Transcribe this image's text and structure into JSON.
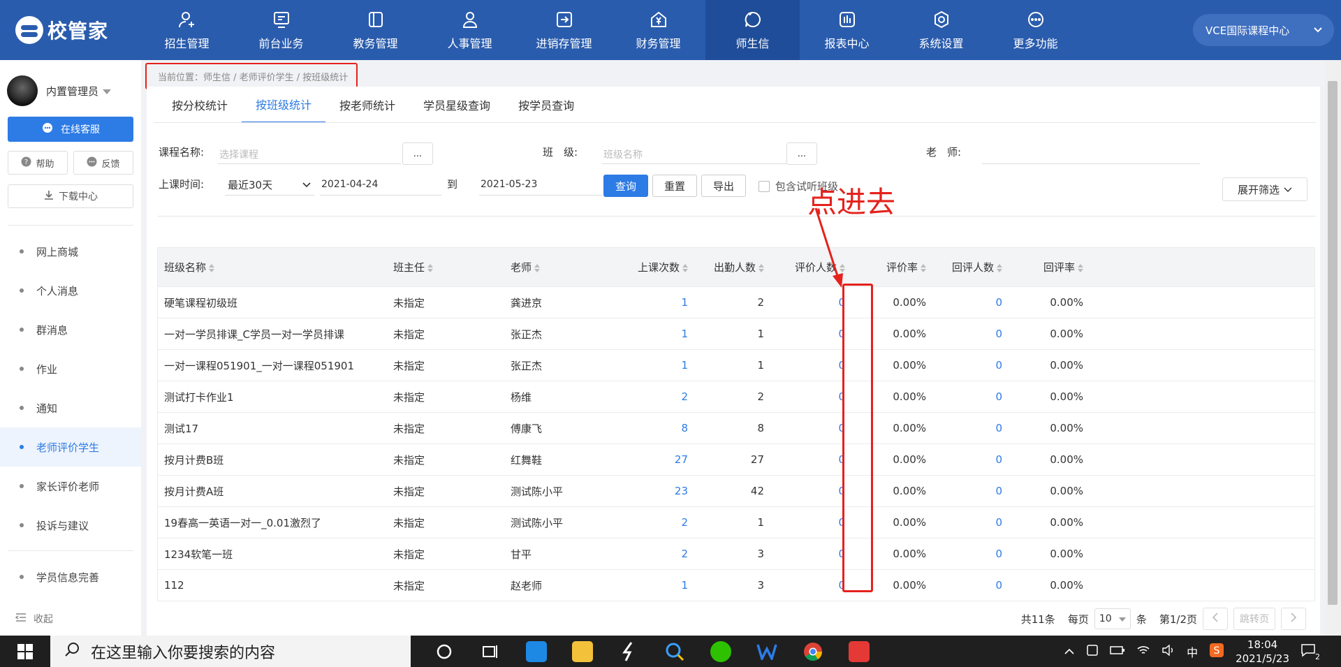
{
  "app": {
    "logo_text": "校管家",
    "campus": "VCE国际课程中心"
  },
  "nav": [
    {
      "label": "招生管理",
      "icon": "user-add-icon"
    },
    {
      "label": "前台业务",
      "icon": "monitor-icon"
    },
    {
      "label": "教务管理",
      "icon": "book-icon"
    },
    {
      "label": "人事管理",
      "icon": "person-icon"
    },
    {
      "label": "进销存管理",
      "icon": "export-icon"
    },
    {
      "label": "财务管理",
      "icon": "yen-icon"
    },
    {
      "label": "师生信",
      "icon": "message-icon",
      "active": true
    },
    {
      "label": "报表中心",
      "icon": "report-icon"
    },
    {
      "label": "系统设置",
      "icon": "settings-icon"
    },
    {
      "label": "更多功能",
      "icon": "more-icon"
    }
  ],
  "sidebar": {
    "user_name": "内置管理员",
    "service_label": "在线客服",
    "help_label": "帮助",
    "feedback_label": "反馈",
    "download_label": "下载中心",
    "items": [
      {
        "label": "网上商城"
      },
      {
        "label": "个人消息"
      },
      {
        "label": "群消息"
      },
      {
        "label": "作业"
      },
      {
        "label": "通知"
      },
      {
        "label": "老师评价学生",
        "active": true
      },
      {
        "label": "家长评价老师"
      },
      {
        "label": "投诉与建议"
      }
    ],
    "extra_item": "学员信息完善",
    "collapse_label": "收起"
  },
  "breadcrumb": "当前位置：师生信 / 老师评价学生 / 按班级统计",
  "tabs": [
    {
      "label": "按分校统计"
    },
    {
      "label": "按班级统计",
      "active": true
    },
    {
      "label": "按老师统计"
    },
    {
      "label": "学员星级查询"
    },
    {
      "label": "按学员查询"
    }
  ],
  "filters": {
    "course_label": "课程名称:",
    "course_placeholder": "选择课程",
    "class_label": "班　级:",
    "class_placeholder": "班级名称",
    "teacher_label": "老　师:",
    "dots": "...",
    "time_label": "上课时间:",
    "time_range": "最近30天",
    "date_from": "2021-04-24",
    "to_label": "到",
    "date_to": "2021-05-23",
    "query_btn": "查询",
    "reset_btn": "重置",
    "export_btn": "导出",
    "trial_label": "包含试听班级",
    "expand_btn": "展开筛选"
  },
  "table": {
    "headers": [
      "班级名称",
      "班主任",
      "老师",
      "上课次数",
      "出勤人数",
      "评价人数",
      "评价率",
      "回评人数",
      "回评率"
    ],
    "rows": [
      [
        "硬笔课程初级班",
        "未指定",
        "龚进京",
        "1",
        "2",
        "0",
        "0.00%",
        "0",
        "0.00%"
      ],
      [
        "一对一学员排课_C学员一对一学员排课",
        "未指定",
        "张正杰",
        "1",
        "1",
        "0",
        "0.00%",
        "0",
        "0.00%"
      ],
      [
        "一对一课程051901_一对一课程051901",
        "未指定",
        "张正杰",
        "1",
        "1",
        "0",
        "0.00%",
        "0",
        "0.00%"
      ],
      [
        "测试打卡作业1",
        "未指定",
        "杨维",
        "2",
        "2",
        "0",
        "0.00%",
        "0",
        "0.00%"
      ],
      [
        "测试17",
        "未指定",
        "傅康飞",
        "8",
        "8",
        "0",
        "0.00%",
        "0",
        "0.00%"
      ],
      [
        "按月计费B班",
        "未指定",
        "红舞鞋",
        "27",
        "27",
        "0",
        "0.00%",
        "0",
        "0.00%"
      ],
      [
        "按月计费A班",
        "未指定",
        "测试陈小平",
        "23",
        "42",
        "0",
        "0.00%",
        "0",
        "0.00%"
      ],
      [
        "19春高一英语一对一_0.01激烈了",
        "未指定",
        "测试陈小平",
        "2",
        "1",
        "0",
        "0.00%",
        "0",
        "0.00%"
      ],
      [
        "1234软笔一班",
        "未指定",
        "甘平",
        "2",
        "3",
        "0",
        "0.00%",
        "0",
        "0.00%"
      ],
      [
        "112",
        "未指定",
        "赵老师",
        "1",
        "3",
        "0",
        "0.00%",
        "0",
        "0.00%"
      ]
    ]
  },
  "pager": {
    "total": "共11条",
    "per_page_label": "每页",
    "per_page": "10",
    "unit": "条",
    "page_info": "第1/2页",
    "jump": "跳转页"
  },
  "annotation": {
    "text": "点进去",
    "color": "#e5221d"
  },
  "taskbar": {
    "search_placeholder": "在这里输入你要搜索的内容",
    "ime": "中",
    "time": "18:04",
    "date": "2021/5/23",
    "notification_count": "2"
  },
  "colors": {
    "brand": "#2a5cad",
    "accent": "#2d7be5"
  }
}
